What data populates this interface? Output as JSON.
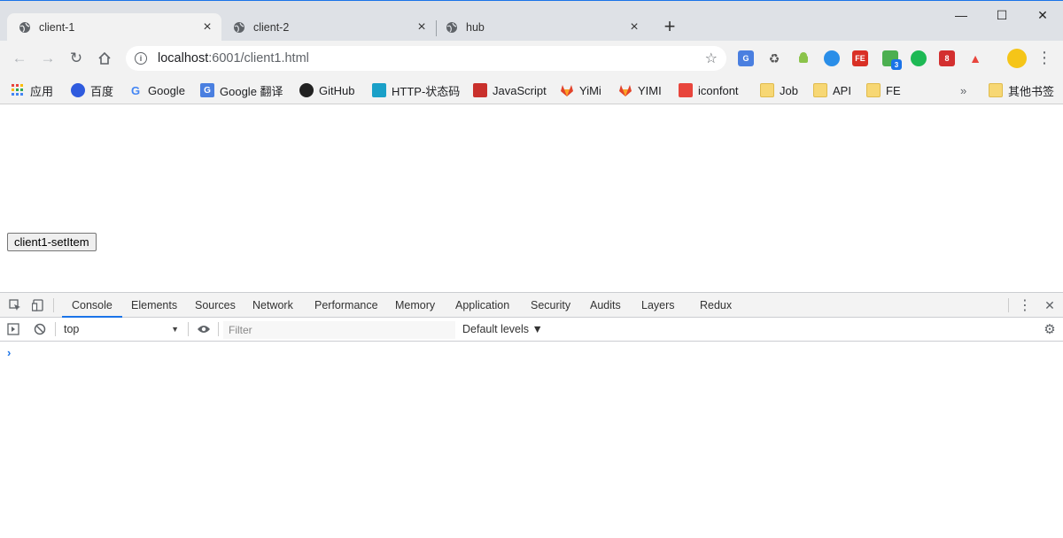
{
  "tabs": [
    {
      "title": "client-1",
      "active": true
    },
    {
      "title": "client-2",
      "active": false
    },
    {
      "title": "hub",
      "active": false
    }
  ],
  "window_controls": {
    "minimize": "—",
    "maximize": "☐",
    "close": "✕"
  },
  "address": {
    "host": "localhost",
    "rest": ":6001/client1.html"
  },
  "bookmarks": [
    {
      "label": "应用",
      "icon": "apps-grid-icon"
    },
    {
      "label": "百度",
      "icon": "baidu-icon"
    },
    {
      "label": "Google",
      "icon": "google-icon"
    },
    {
      "label": "Google 翻译",
      "icon": "google-translate-icon"
    },
    {
      "label": "GitHub",
      "icon": "github-icon"
    },
    {
      "label": "HTTP-状态码",
      "icon": "http-icon"
    },
    {
      "label": "JavaScript",
      "icon": "javascript-icon"
    },
    {
      "label": "YiMi",
      "icon": "gitlab-icon"
    },
    {
      "label": "YIMI",
      "icon": "gitlab-icon"
    },
    {
      "label": "iconfont",
      "icon": "iconfont-icon"
    },
    {
      "label": "Job",
      "icon": "folder-icon"
    },
    {
      "label": "API",
      "icon": "folder-icon"
    },
    {
      "label": "FE",
      "icon": "folder-icon"
    },
    {
      "label": "其他书签",
      "icon": "folder-icon"
    }
  ],
  "bookmarks_overflow": "»",
  "page": {
    "button_label": "client1-setItem"
  },
  "devtools": {
    "tabs": [
      "Console",
      "Elements",
      "Sources",
      "Network",
      "Performance",
      "Memory",
      "Application",
      "Security",
      "Audits",
      "Layers",
      "Redux"
    ],
    "active_tab": "Console",
    "context": "top",
    "filter_placeholder": "Filter",
    "levels_label": "Default levels ▼",
    "prompt": "›"
  },
  "extension_badge": "3",
  "colors": {
    "accent": "#1a73e8",
    "tabstrip": "#dee1e6",
    "toolbar": "#f2f2f2"
  }
}
